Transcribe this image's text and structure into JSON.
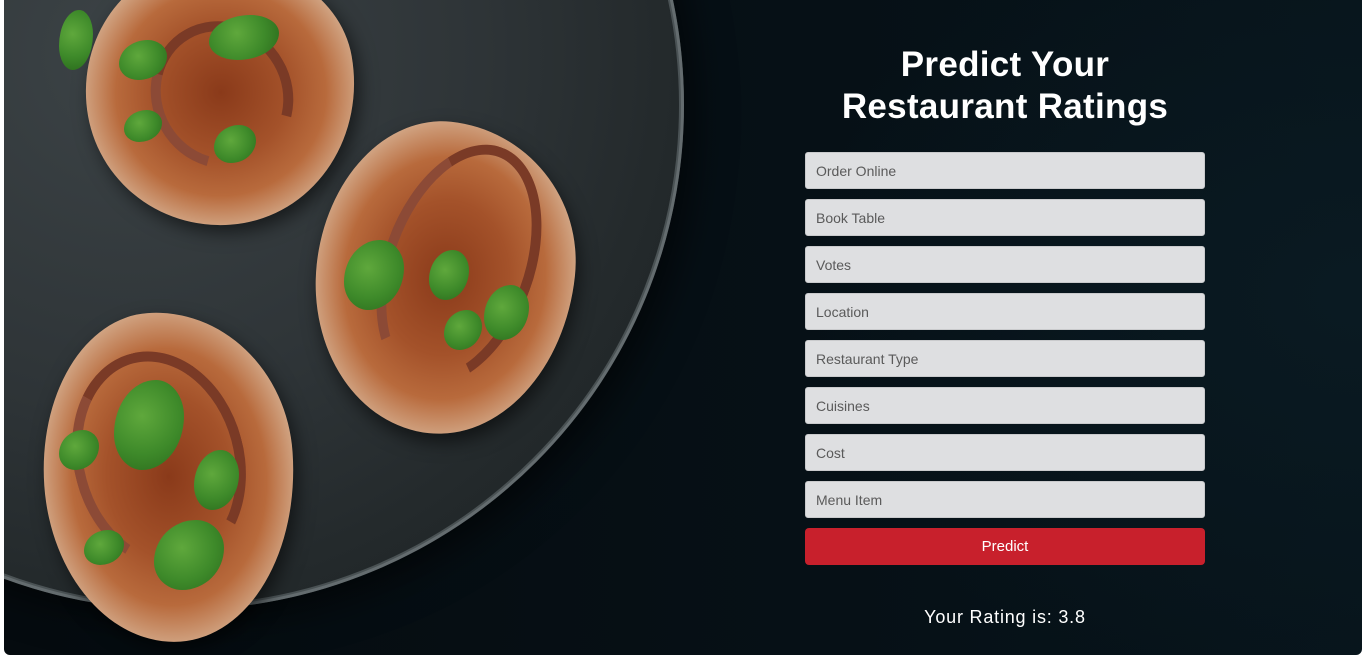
{
  "header": {
    "title_line1": "Predict Your",
    "title_line2": "Restaurant Ratings"
  },
  "form": {
    "fields": [
      {
        "placeholder": "Order Online",
        "value": ""
      },
      {
        "placeholder": "Book Table",
        "value": ""
      },
      {
        "placeholder": "Votes",
        "value": ""
      },
      {
        "placeholder": "Location",
        "value": ""
      },
      {
        "placeholder": "Restaurant Type",
        "value": ""
      },
      {
        "placeholder": "Cuisines",
        "value": ""
      },
      {
        "placeholder": "Cost",
        "value": ""
      },
      {
        "placeholder": "Menu Item",
        "value": ""
      }
    ],
    "submit_label": "Predict"
  },
  "result": {
    "text": "Your Rating is: 3.8"
  },
  "colors": {
    "button": "#c8202c",
    "input_bg": "#dedfe1",
    "background": "#061016"
  }
}
